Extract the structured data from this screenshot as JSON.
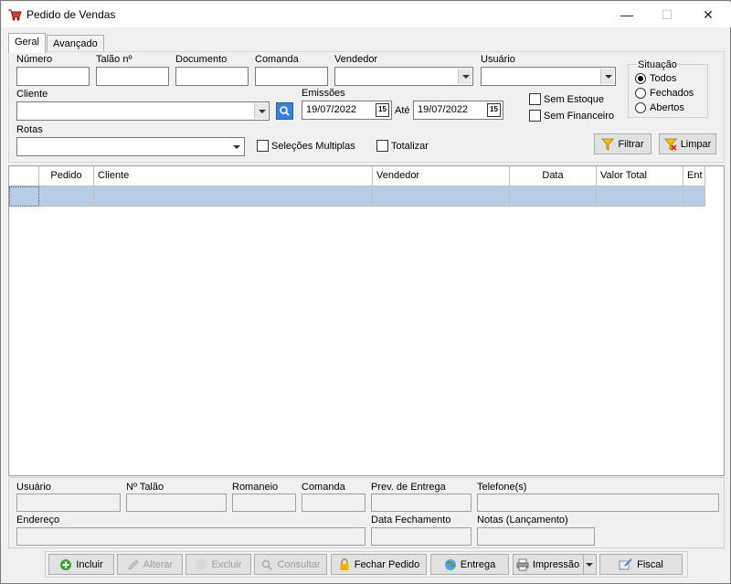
{
  "window": {
    "title": "Pedido de Vendas",
    "minimize": "—",
    "maximize": "☐",
    "close": "✕"
  },
  "tabs": [
    {
      "label": "Geral"
    },
    {
      "label": "Avançado"
    }
  ],
  "filters": {
    "numero_label": "Número",
    "talao_label": "Talão nº",
    "documento_label": "Documento",
    "comanda_label": "Comanda",
    "vendedor_label": "Vendedor",
    "usuario_label": "Usuário",
    "cliente_label": "Cliente",
    "emissoes_label": "Emissões",
    "data_inicio": "19/07/2022",
    "ate_label": "Até",
    "data_fim": "19/07/2022",
    "cal_glyph": "15",
    "rotas_label": "Rotas",
    "selecoes_multiplas": "Seleções Multiplas",
    "totalizar": "Totalizar",
    "sem_estoque": "Sem Estoque",
    "sem_financeiro": "Sem Financeiro"
  },
  "situacao": {
    "title": "Situação",
    "options": [
      {
        "label": "Todos",
        "checked": true
      },
      {
        "label": "Fechados"
      },
      {
        "label": "Abertos"
      }
    ]
  },
  "actions": {
    "filtrar": "Filtrar",
    "limpar": "Limpar"
  },
  "grid": {
    "columns": [
      "",
      "Pedido",
      "Cliente",
      "Vendedor",
      "Data",
      "Valor Total",
      "Ent"
    ],
    "selection_color": "#b8cce4"
  },
  "details": {
    "usuario": "Usuário",
    "talao": "Nº Talão",
    "romaneio": "Romaneio",
    "comanda": "Comanda",
    "prev_entrega": "Prev. de Entrega",
    "telefones": "Telefone(s)",
    "endereco": "Endereço",
    "data_fechamento": "Data Fechamento",
    "notas": "Notas (Lançamento)"
  },
  "toolbar": {
    "incluir": "Incluir",
    "alterar": "Alterar",
    "excluir": "Excluir",
    "consultar": "Consultar",
    "fechar_pedido": "Fechar Pedido",
    "entrega": "Entrega",
    "impressao": "Impressão",
    "fiscal": "Fiscal"
  },
  "colors": {
    "accent": "#2a6ebb",
    "selection": "#b8cce4",
    "add_green": "#3ca03c"
  }
}
